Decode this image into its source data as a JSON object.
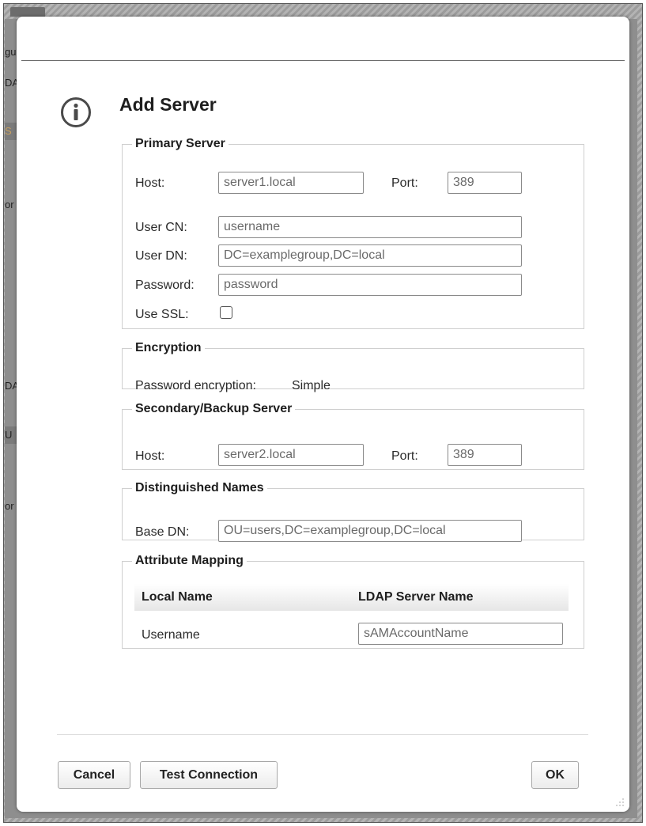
{
  "background": {
    "fragments": [
      "gu",
      "DA",
      "S",
      "or",
      "DA",
      "U",
      "or"
    ]
  },
  "dialog": {
    "title": "Add Server",
    "icon": "info-icon"
  },
  "primary_server": {
    "legend": "Primary Server",
    "host_label": "Host:",
    "host_value": "server1.local",
    "port_label": "Port:",
    "port_value": "389",
    "user_cn_label": "User CN:",
    "user_cn_value": "username",
    "user_dn_label": "User DN:",
    "user_dn_value": "DC=examplegroup,DC=local",
    "password_label": "Password:",
    "password_value": "password",
    "use_ssl_label": "Use SSL:",
    "use_ssl_checked": false
  },
  "encryption": {
    "legend": "Encryption",
    "label": "Password encryption:",
    "value": "Simple"
  },
  "secondary_server": {
    "legend": "Secondary/Backup Server",
    "host_label": "Host:",
    "host_value": "server2.local",
    "port_label": "Port:",
    "port_value": "389"
  },
  "distinguished_names": {
    "legend": "Distinguished Names",
    "base_dn_label": "Base DN:",
    "base_dn_value": "OU=users,DC=examplegroup,DC=local"
  },
  "attribute_mapping": {
    "legend": "Attribute Mapping",
    "columns": [
      "Local Name",
      "LDAP Server Name"
    ],
    "rows": [
      {
        "local": "Username",
        "ldap": "sAMAccountName"
      }
    ]
  },
  "buttons": {
    "cancel": "Cancel",
    "test_connection": "Test Connection",
    "ok": "OK"
  }
}
